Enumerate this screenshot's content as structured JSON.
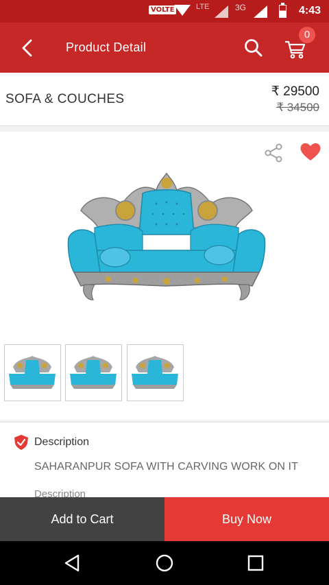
{
  "status_bar": {
    "volte": "VOLTE",
    "lte": "LTE",
    "network": "3G",
    "time": "4:43"
  },
  "app_bar": {
    "title": "Product Detail",
    "cart_count": "0",
    "back_icon": "back-arrow-icon",
    "search_icon": "search-icon",
    "cart_icon": "cart-icon"
  },
  "product": {
    "name": "SOFA & COUCHES",
    "price": "₹ 29500",
    "old_price": "₹ 34500",
    "share_icon": "share-icon",
    "favorite_icon": "heart-icon",
    "favorite_color": "#ef5350",
    "upholstery_color": "#29b6d8",
    "thumbnails": [
      "thumb-1",
      "thumb-2",
      "thumb-3"
    ]
  },
  "description": {
    "label": "Description",
    "text": "SAHARANPUR SOFA WITH CARVING WORK ON IT",
    "more_label": "Description"
  },
  "actions": {
    "add_to_cart": "Add to Cart",
    "buy_now": "Buy Now"
  },
  "colors": {
    "brand": "#c62828",
    "buy_button": "#e53935",
    "cart_button": "#424242"
  }
}
